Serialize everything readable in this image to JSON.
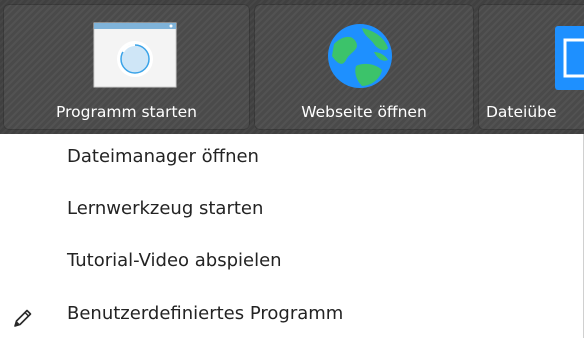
{
  "toolbar": {
    "buttons": [
      {
        "label": "Programm starten",
        "icon": "application-window-icon"
      },
      {
        "label": "Webseite öffnen",
        "icon": "globe-icon"
      },
      {
        "label": "Dateiübe",
        "icon": "file-manager-icon"
      }
    ]
  },
  "menu": {
    "items": [
      {
        "label": "Dateimanager öffnen"
      },
      {
        "label": "Lernwerkzeug starten"
      },
      {
        "label": "Tutorial-Video abspielen"
      },
      {
        "label": "Benutzerdefiniertes Programm",
        "icon": "pencil-icon"
      }
    ]
  },
  "colors": {
    "toolbar_bg": "#404040",
    "button_bg": "#4a4a4a",
    "label_text": "#ffffff",
    "menu_text": "#232323",
    "globe_blue": "#1e90ff",
    "globe_green": "#3cc36a",
    "window_blue": "#3aa3e8"
  }
}
